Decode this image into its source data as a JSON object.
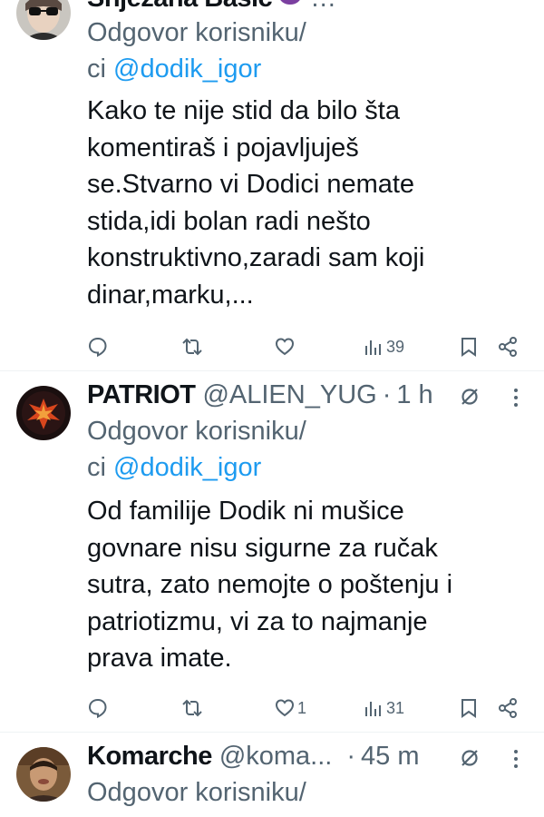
{
  "tweets": [
    {
      "name": "Snježana Bašić",
      "name_suffix": "…",
      "reply_label": "Odgovor korisniku/",
      "reply_prefix": "ci ",
      "reply_handle": "@dodik_igor",
      "text": "Kako te nije stid da bilo šta\nkomentiraš i pojavljuješ\nse.Stvarno vi Dodici nemate\nstida,idi bolan radi nešto\nkonstruktivno,zaradi sam koji\ndinar,marku,...",
      "actions": {
        "reply": "",
        "retweet": "",
        "likes": "",
        "views": "39"
      }
    },
    {
      "name": "PATRIOT",
      "handle": "@ALIEN_YUG",
      "separator": "·",
      "time": "1 h",
      "reply_label": "Odgovor korisniku/",
      "reply_prefix": "ci ",
      "reply_handle": "@dodik_igor",
      "text": "Od familije Dodik ni mušice\ngovnare nisu sigurne za ručak\nsutra, zato nemojte o poštenju i\npatriotizmu, vi za to najmanje\nprava imate.",
      "actions": {
        "reply": "",
        "retweet": "",
        "likes": "1",
        "views": "31"
      }
    },
    {
      "name": "Komarche",
      "handle": "@koma...",
      "separator": "·",
      "time": "45 m",
      "reply_label": "Odgovor korisniku/"
    }
  ],
  "icons": {
    "reply": "reply-icon",
    "retweet": "retweet-icon",
    "like": "heart-icon",
    "views": "views-icon",
    "bookmark": "bookmark-icon",
    "share": "share-icon",
    "grok": "grok-icon",
    "more": "more-icon"
  },
  "colors": {
    "text": "#0f1419",
    "secondary": "#536471",
    "link": "#1d9bf0",
    "divider": "#eff3f4"
  }
}
